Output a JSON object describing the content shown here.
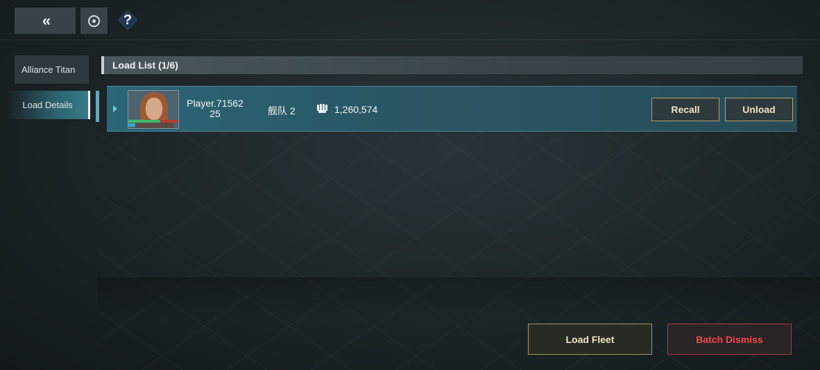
{
  "topbar": {
    "back_icon": "double-chevron-left-icon",
    "back_glyph": "«",
    "refresh_icon": "refresh-icon",
    "help_icon": "help-icon",
    "help_glyph": "?"
  },
  "sidebar": {
    "items": [
      {
        "label": "Alliance Titan",
        "active": false
      },
      {
        "label": "Load Details",
        "active": true
      }
    ]
  },
  "load_list": {
    "header": "Load List (1/6)",
    "rows": [
      {
        "player_name": "Player.71562\n25",
        "fleet_label": "舰队 2",
        "power_icon": "fist-icon",
        "power": "1,260,574",
        "recall_label": "Recall",
        "unload_label": "Unload"
      }
    ]
  },
  "footer": {
    "load_fleet_label": "Load Fleet",
    "batch_dismiss_label": "Batch Dismiss"
  },
  "colors": {
    "accent_teal": "#5fd2d0",
    "gold_border": "#b9a36d",
    "danger_red": "#ef4b4b"
  }
}
